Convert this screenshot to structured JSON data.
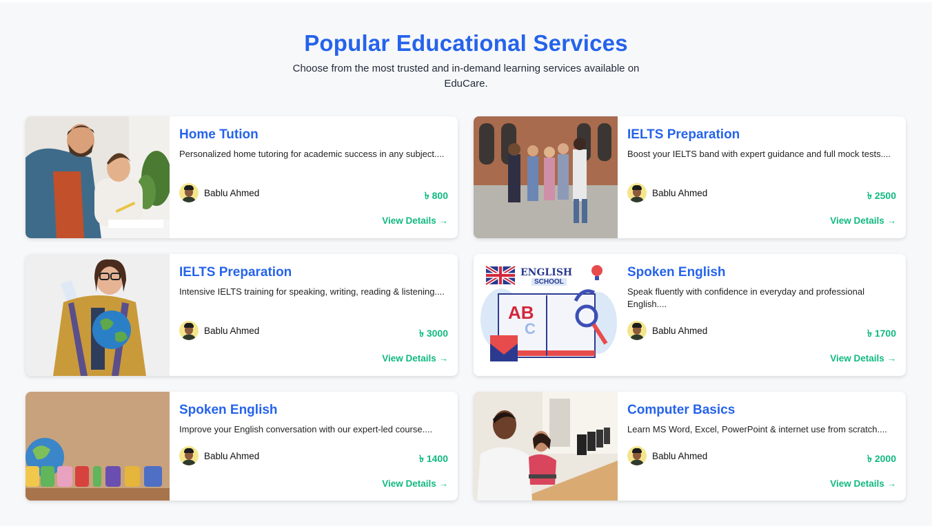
{
  "section": {
    "title": "Popular Educational Services",
    "subtitle": "Choose from the most trusted and in-demand learning services available on EduCare."
  },
  "colors": {
    "accent": "#2563eb",
    "price": "#10b981",
    "background": "#f7f8fa"
  },
  "details_label": "View Details →",
  "cards": [
    {
      "title": "Home Tution",
      "description": "Personalized home tutoring for academic success in any subject....",
      "author": "Bablu Ahmed",
      "price": "৳ 800",
      "image": "tutor-with-student-photo"
    },
    {
      "title": "IELTS Preparation",
      "description": "Boost your IELTS band with expert guidance and full mock tests....",
      "author": "Bablu Ahmed",
      "price": "৳ 2500",
      "image": "students-walking-campus-photo"
    },
    {
      "title": "IELTS Preparation",
      "description": "Intensive IELTS training for speaking, writing, reading & listening....",
      "author": "Bablu Ahmed",
      "price": "৳ 3000",
      "image": "woman-holding-globe-photo"
    },
    {
      "title": "Spoken English",
      "description": "Speak fluently with confidence in everyday and professional English....",
      "author": "Bablu Ahmed",
      "price": "৳ 1700",
      "image": "english-school-illustration"
    },
    {
      "title": "Spoken English",
      "description": "Improve your English conversation with our expert-led course....",
      "author": "Bablu Ahmed",
      "price": "৳ 1400",
      "image": "english-letters-photo"
    },
    {
      "title": "Computer Basics",
      "description": "Learn MS Word, Excel, PowerPoint & internet use from scratch....",
      "author": "Bablu Ahmed",
      "price": "৳ 2000",
      "image": "computer-lab-photo"
    }
  ]
}
